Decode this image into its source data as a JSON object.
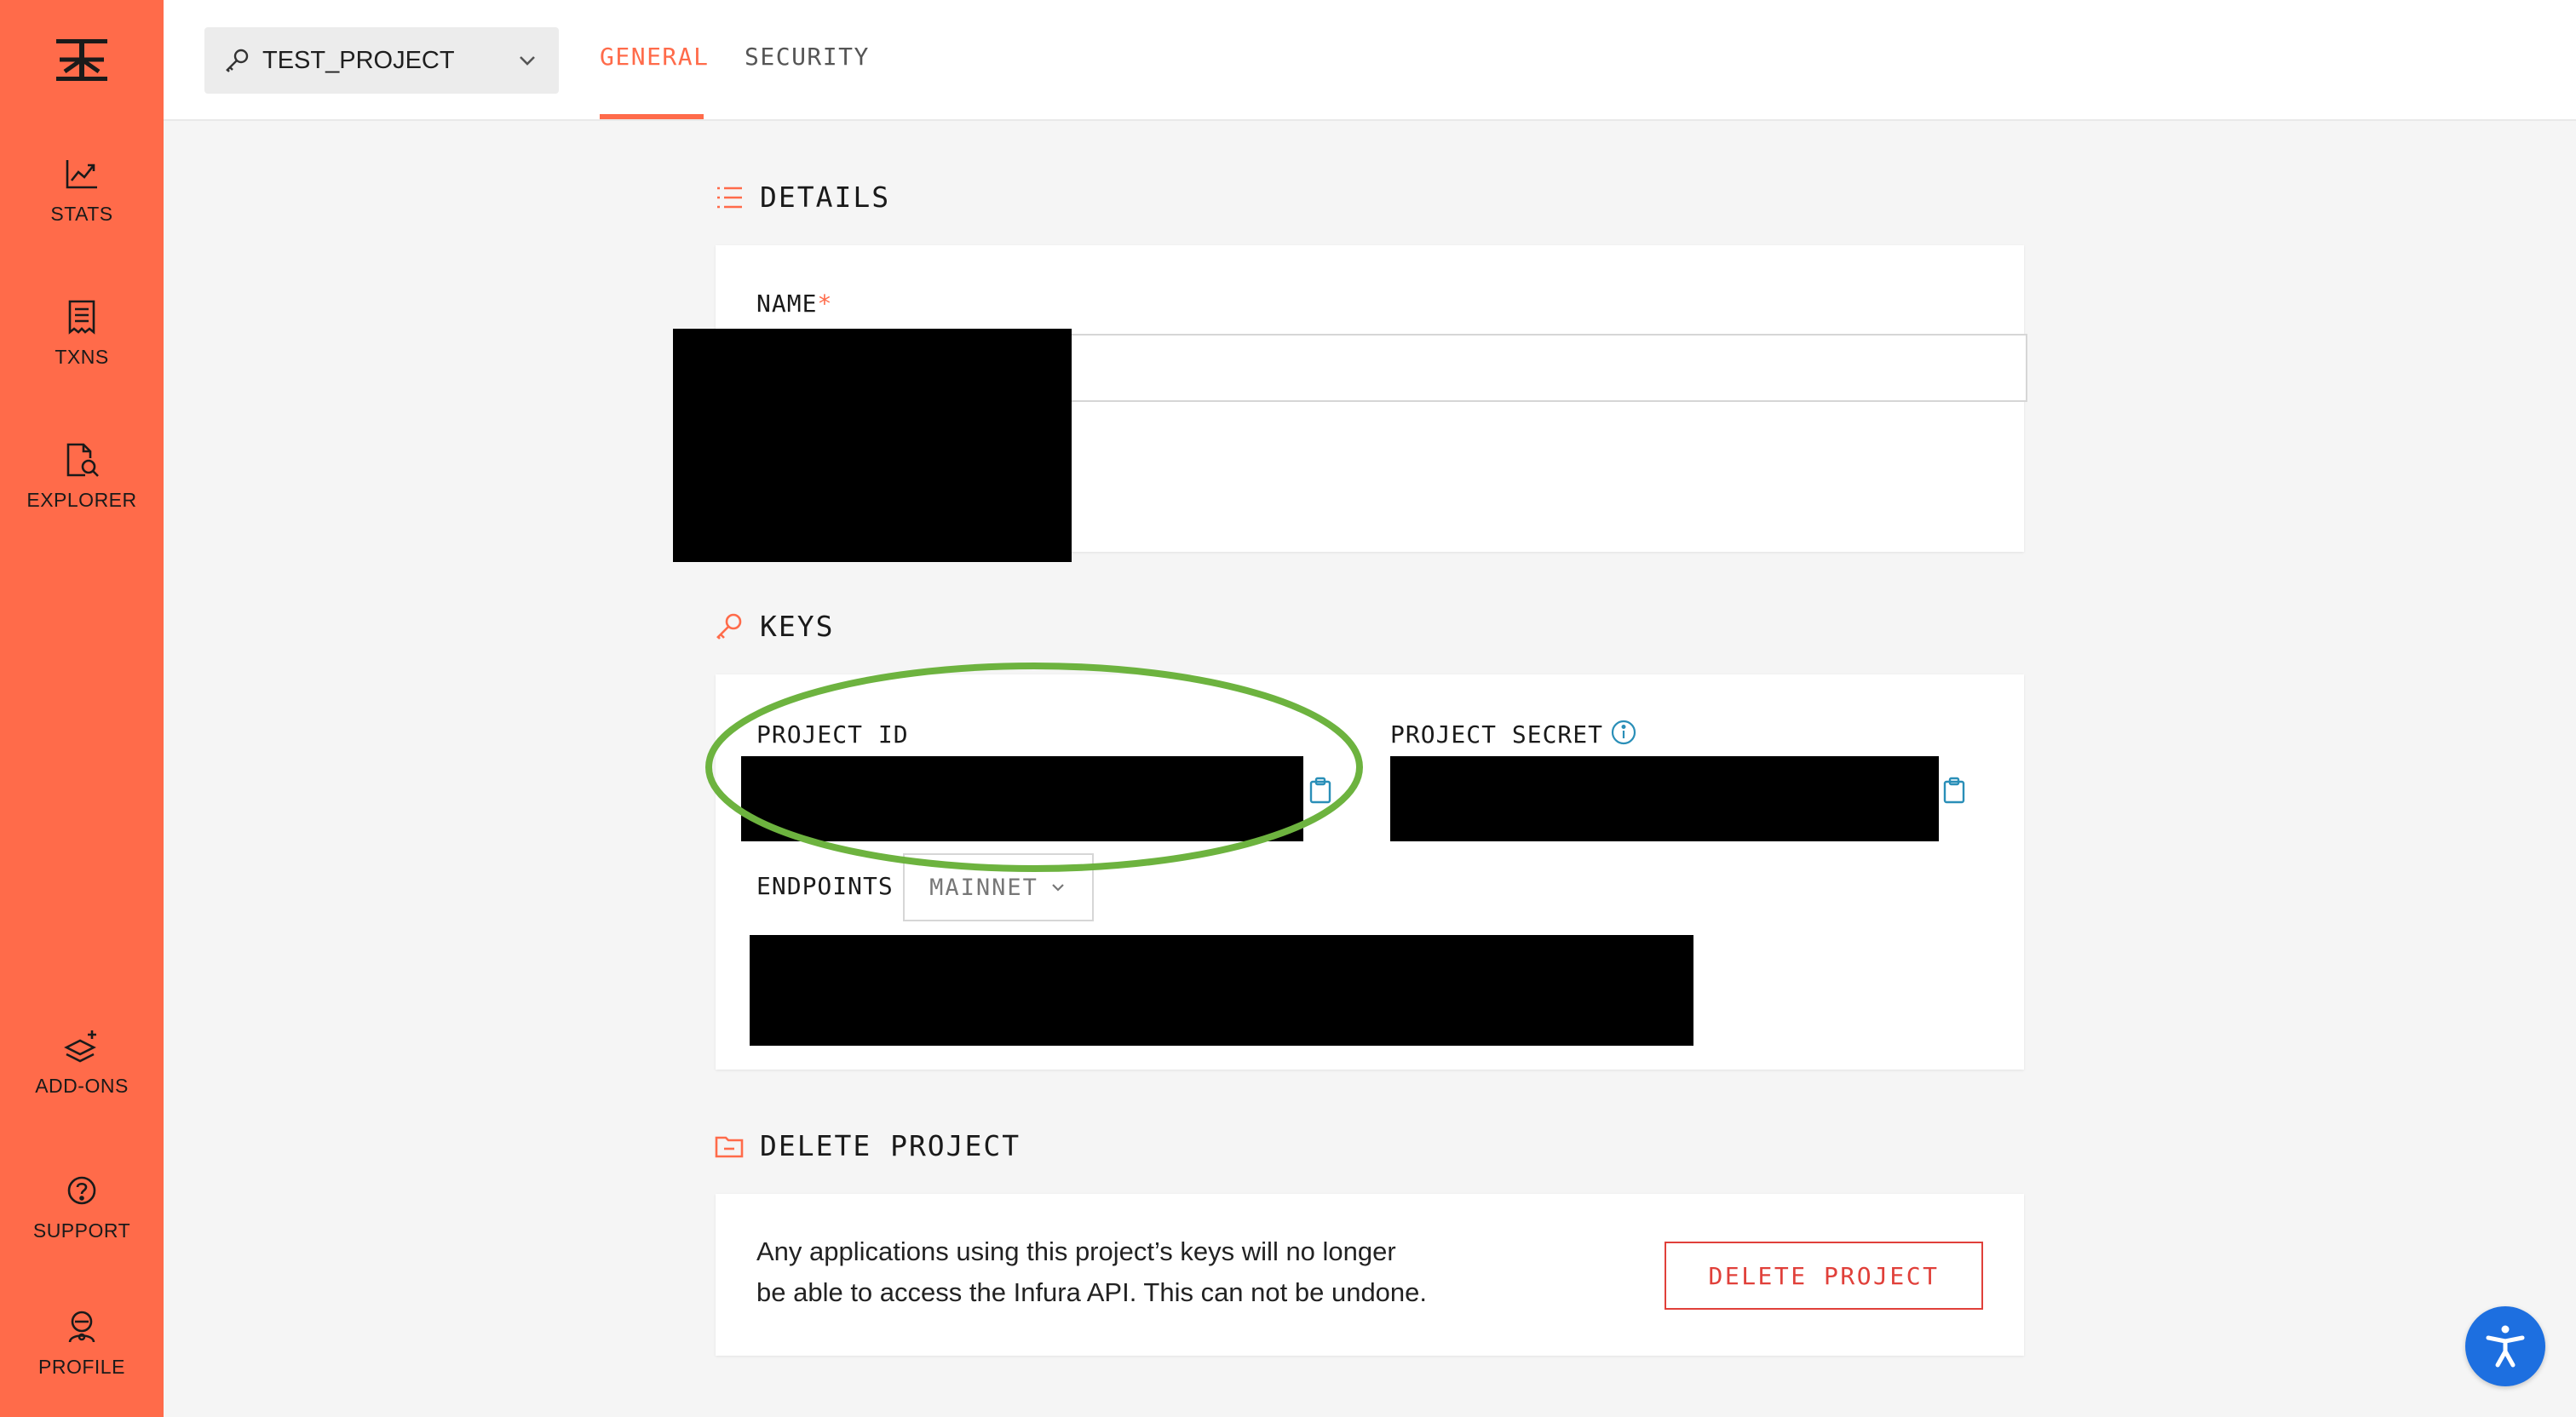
{
  "sidebar": {
    "items": [
      {
        "label": "STATS",
        "icon": "stats-icon"
      },
      {
        "label": "TXNS",
        "icon": "receipt-icon"
      },
      {
        "label": "EXPLORER",
        "icon": "explorer-icon"
      },
      {
        "label": "ADD-ONS",
        "icon": "add-ons-icon"
      },
      {
        "label": "SUPPORT",
        "icon": "help-icon"
      },
      {
        "label": "PROFILE",
        "icon": "profile-icon"
      }
    ]
  },
  "header": {
    "project_name": "TEST_PROJECT",
    "tabs": [
      {
        "label": "GENERAL",
        "active": true
      },
      {
        "label": "SECURITY",
        "active": false
      }
    ]
  },
  "details": {
    "title": "DETAILS",
    "name_label": "NAME",
    "required_mark": "*"
  },
  "keys": {
    "title": "KEYS",
    "project_id_label": "PROJECT ID",
    "project_secret_label": "PROJECT SECRET",
    "endpoints_label": "ENDPOINTS",
    "network": "MAINNET"
  },
  "delete": {
    "title": "DELETE PROJECT",
    "warning_line1": "Any applications using this project’s keys will no longer",
    "warning_line2": "be able to access the Infura API. This can not be undone.",
    "button_label": "DELETE PROJECT"
  },
  "colors": {
    "brand": "#ff6b4a",
    "danger": "#e0403a",
    "annotation": "#6db33f",
    "accessibility": "#1d6fe0",
    "clipboard": "#2a8fb8"
  }
}
